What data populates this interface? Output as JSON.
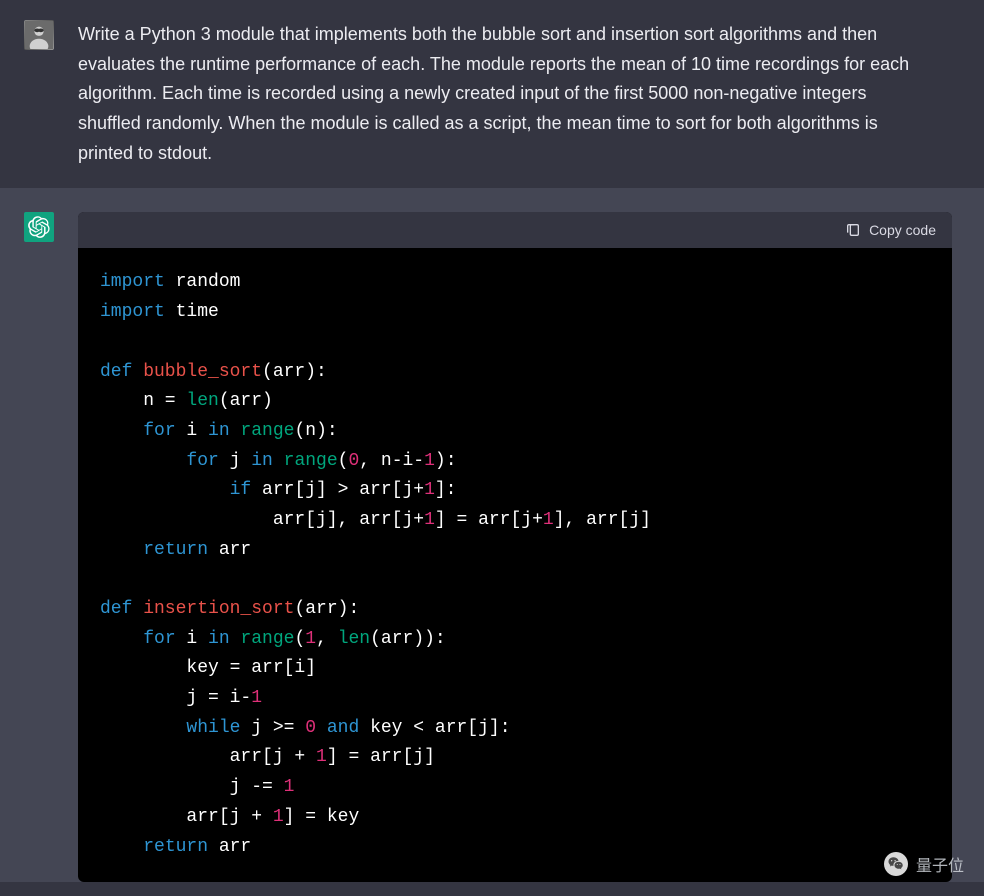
{
  "user_message": "Write a Python 3 module that implements both the bubble sort and insertion sort algorithms and then evaluates the runtime performance of each. The module reports the mean of 10 time recordings for each algorithm. Each time is recorded using a newly created input of the first 5000 non-negative integers shuffled randomly. When the module is called as a script, the mean time to sort for both algorithms is printed to stdout.",
  "copy_label": "Copy code",
  "code": {
    "line1_kw1": "import",
    "line1_mod": " random",
    "line2_kw1": "import",
    "line2_mod": " time",
    "line4_kw": "def",
    "line4_fn": " bubble_sort",
    "line4_rest": "(arr):",
    "line5_pre": "    n = ",
    "line5_bi": "len",
    "line5_rest": "(arr)",
    "line6_pre": "    ",
    "line6_kw1": "for",
    "line6_mid1": " i ",
    "line6_kw2": "in",
    "line6_mid2": " ",
    "line6_bi": "range",
    "line6_rest": "(n):",
    "line7_pre": "        ",
    "line7_kw1": "for",
    "line7_mid1": " j ",
    "line7_kw2": "in",
    "line7_mid2": " ",
    "line7_bi": "range",
    "line7_p1": "(",
    "line7_n1": "0",
    "line7_mid3": ", n-i-",
    "line7_n2": "1",
    "line7_rest": "):",
    "line8_pre": "            ",
    "line8_kw": "if",
    "line8_mid": " arr[j] > arr[j+",
    "line8_n": "1",
    "line8_rest": "]:",
    "line9_pre": "                arr[j], arr[j+",
    "line9_n1": "1",
    "line9_mid": "] = arr[j+",
    "line9_n2": "1",
    "line9_rest": "], arr[j]",
    "line10_pre": "    ",
    "line10_kw": "return",
    "line10_rest": " arr",
    "line12_kw": "def",
    "line12_fn": " insertion_sort",
    "line12_rest": "(arr):",
    "line13_pre": "    ",
    "line13_kw1": "for",
    "line13_mid1": " i ",
    "line13_kw2": "in",
    "line13_mid2": " ",
    "line13_bi1": "range",
    "line13_p1": "(",
    "line13_n": "1",
    "line13_mid3": ", ",
    "line13_bi2": "len",
    "line13_rest": "(arr)):",
    "line14": "        key = arr[i]",
    "line15_pre": "        j = i-",
    "line15_n": "1",
    "line16_pre": "        ",
    "line16_kw1": "while",
    "line16_mid1": " j >= ",
    "line16_n": "0",
    "line16_mid2": " ",
    "line16_kw2": "and",
    "line16_rest": " key < arr[j]:",
    "line17_pre": "            arr[j + ",
    "line17_n": "1",
    "line17_rest": "] = arr[j]",
    "line18_pre": "            j -= ",
    "line18_n": "1",
    "line19_pre": "        arr[j + ",
    "line19_n": "1",
    "line19_rest": "] = key",
    "line20_pre": "    ",
    "line20_kw": "return",
    "line20_rest": " arr"
  },
  "watermark": "量子位"
}
